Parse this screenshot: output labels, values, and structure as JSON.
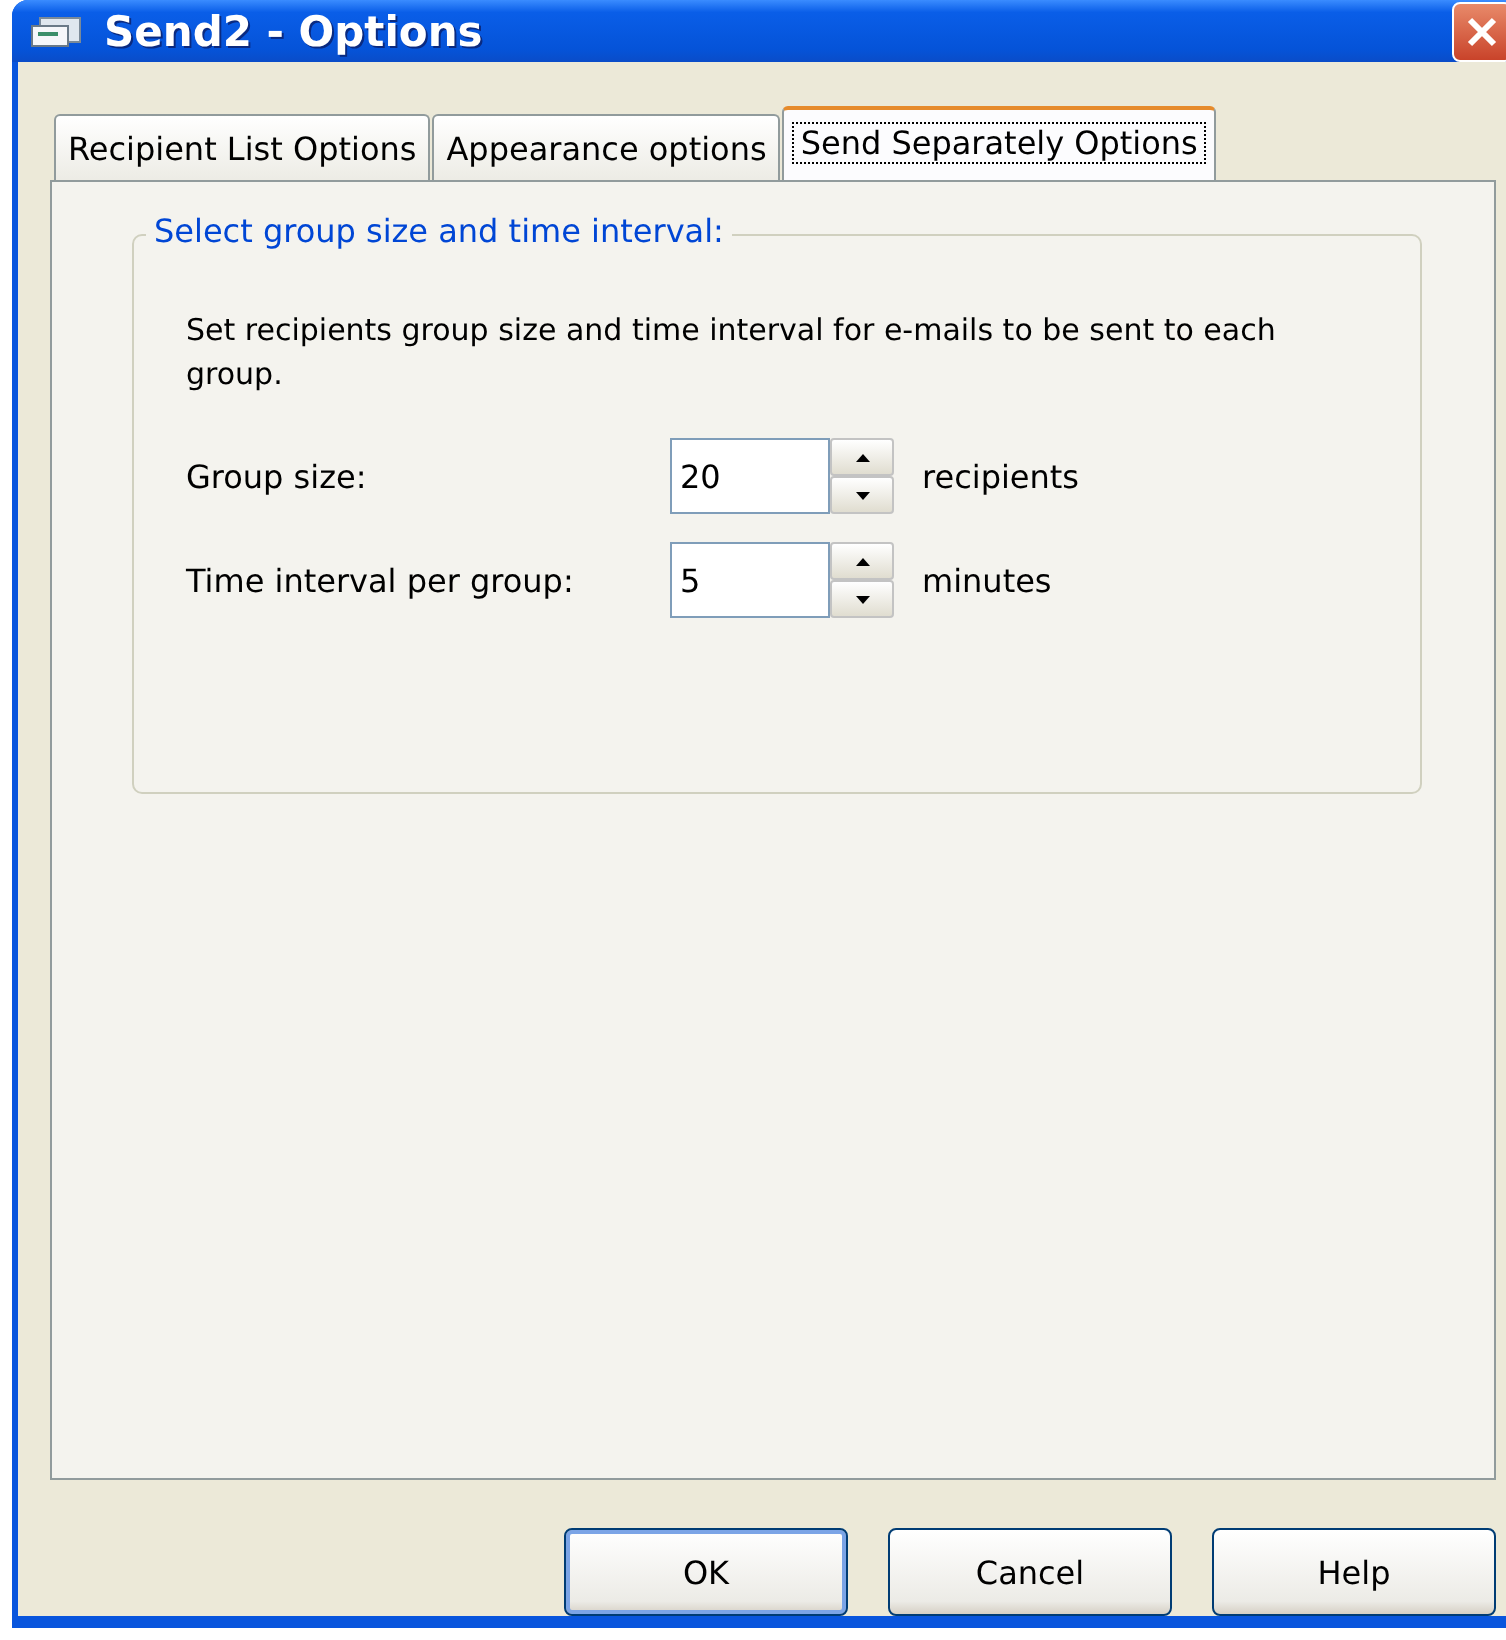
{
  "window": {
    "title": "Send2 - Options"
  },
  "tabs": [
    {
      "label": "Recipient List Options",
      "selected": false
    },
    {
      "label": "Appearance options",
      "selected": false
    },
    {
      "label": "Send Separately Options",
      "selected": true
    }
  ],
  "group": {
    "title": "Select group size and time interval:",
    "description": "Set recipients group size and time interval for e-mails to be sent to each group.",
    "fields": [
      {
        "label": "Group size:",
        "value": "20",
        "unit": "recipients"
      },
      {
        "label": "Time interval per group:",
        "value": "5",
        "unit": "minutes"
      }
    ]
  },
  "buttons": [
    {
      "label": "OK",
      "default": true
    },
    {
      "label": "Cancel",
      "default": false
    },
    {
      "label": "Help",
      "default": false
    }
  ]
}
